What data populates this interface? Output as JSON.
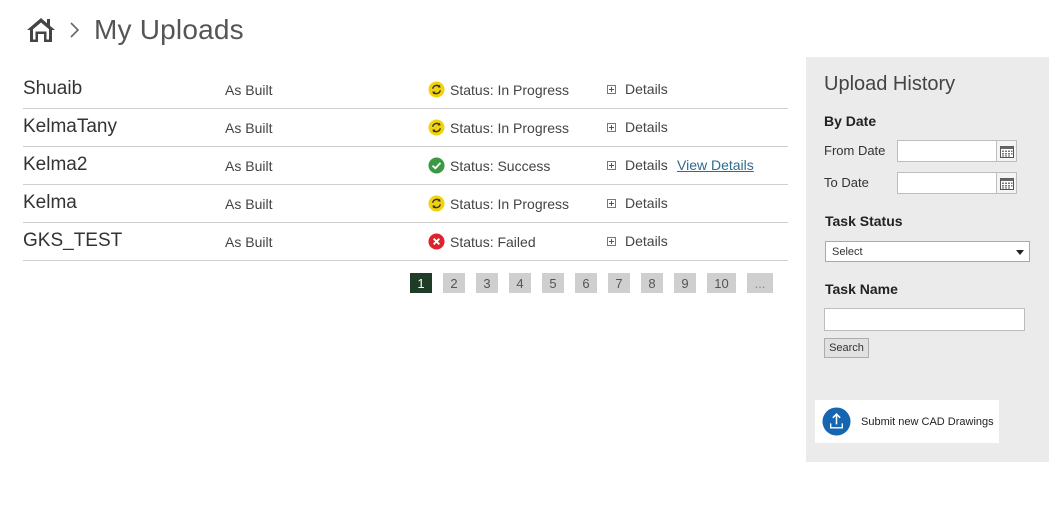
{
  "breadcrumb": {
    "home_icon": "home-icon",
    "separator_icon": "chevron-right-icon",
    "title": "My Uploads"
  },
  "uploads": [
    {
      "name": "Shuaib",
      "type": "As Built",
      "status": "Status: In Progress",
      "status_kind": "in-progress",
      "details": "Details",
      "view_details": ""
    },
    {
      "name": "KelmaTany",
      "type": "As Built",
      "status": "Status: In Progress",
      "status_kind": "in-progress",
      "details": "Details",
      "view_details": ""
    },
    {
      "name": "Kelma2",
      "type": "As Built",
      "status": "Status: Success",
      "status_kind": "success",
      "details": "Details",
      "view_details": "View Details"
    },
    {
      "name": "Kelma",
      "type": "As Built",
      "status": "Status: In Progress",
      "status_kind": "in-progress",
      "details": "Details",
      "view_details": ""
    },
    {
      "name": "GKS_TEST",
      "type": "As Built",
      "status": "Status: Failed",
      "status_kind": "failed",
      "details": "Details",
      "view_details": ""
    }
  ],
  "status_colors": {
    "in_progress": "#f2d30a",
    "success": "#3a9a43",
    "failed": "#e0222b"
  },
  "pagination": {
    "pages": [
      "1",
      "2",
      "3",
      "4",
      "5",
      "6",
      "7",
      "8",
      "9",
      "10",
      "..."
    ],
    "current": "1",
    "active_color": "#1f3d26"
  },
  "sidebar": {
    "title": "Upload History",
    "by_date": "By Date",
    "from_date_label": "From Date",
    "from_date_value": "",
    "to_date_label": "To Date",
    "to_date_value": "",
    "calendar_icon": "calendar-icon",
    "task_status_label": "Task Status",
    "task_status_selected": "Select",
    "task_name_label": "Task Name",
    "task_name_value": "",
    "search_label": "Search",
    "submit_label": "Submit new CAD Drawings",
    "submit_icon": "upload-icon",
    "accent": "#1565b0"
  }
}
